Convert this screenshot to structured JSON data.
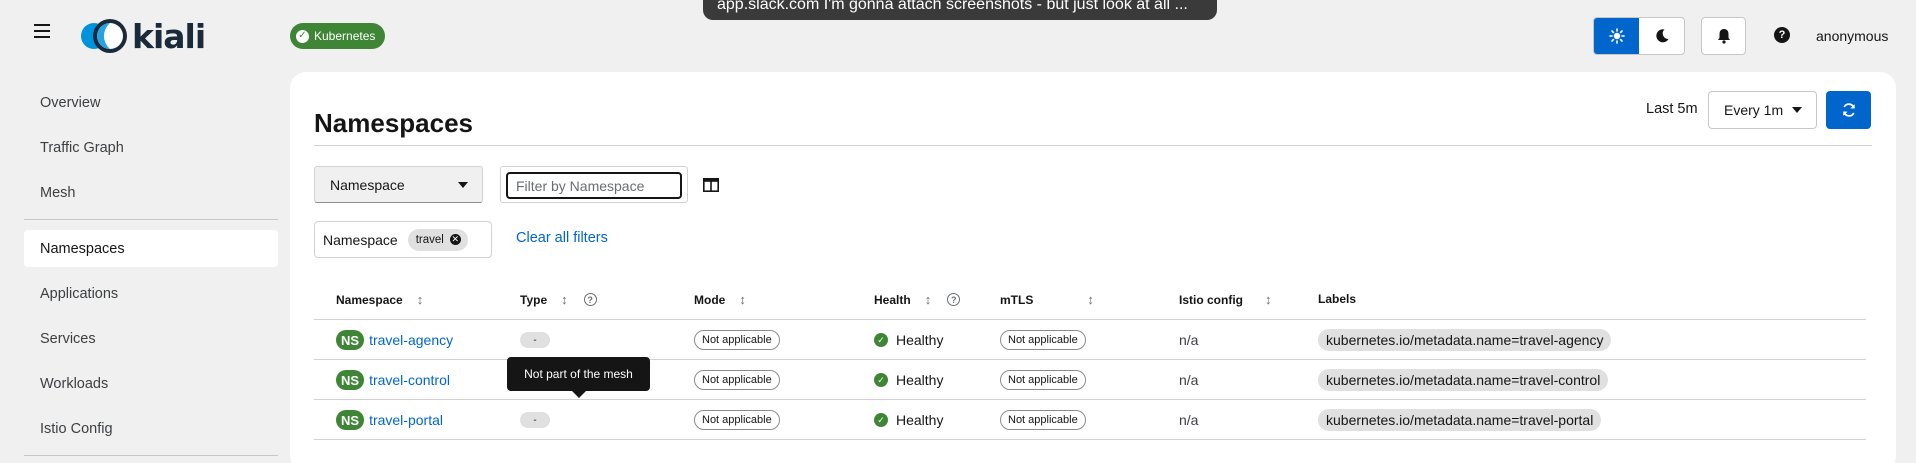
{
  "header": {
    "logo_text": "kiali",
    "cluster_badge": "Kubernetes",
    "toast_text": "app.slack.com   I'm gonna attach screenshots  - but just look at all ...",
    "user": "anonymous",
    "icons": {
      "menu": "hamburger-icon",
      "light_theme": "sun-icon",
      "dark_theme": "moon-icon",
      "notifications": "bell-icon",
      "help": "help-icon"
    }
  },
  "sidebar": {
    "items": [
      {
        "label": "Overview"
      },
      {
        "label": "Traffic Graph"
      },
      {
        "label": "Mesh"
      },
      {
        "label": "Namespaces",
        "active": true
      },
      {
        "label": "Applications"
      },
      {
        "label": "Services"
      },
      {
        "label": "Workloads"
      },
      {
        "label": "Istio Config"
      }
    ]
  },
  "main": {
    "title": "Namespaces",
    "time_range": "Last 5m",
    "refresh_interval": "Every 1m",
    "filter": {
      "type_label": "Namespace",
      "placeholder": "Filter by Namespace"
    },
    "active_filters": {
      "category": "Namespace",
      "chips": [
        "travel"
      ],
      "clear_label": "Clear all filters"
    },
    "table": {
      "columns": [
        "Namespace",
        "Type",
        "Mode",
        "Health",
        "mTLS",
        "Istio config",
        "Labels"
      ],
      "rows": [
        {
          "badge": "NS",
          "namespace": "travel-agency",
          "type": "-",
          "mode": "Not applicable",
          "health": "Healthy",
          "mtls": "Not applicable",
          "istio_config": "n/a",
          "labels": "kubernetes.io/metadata.name=travel-agency"
        },
        {
          "badge": "NS",
          "namespace": "travel-control",
          "type": "-",
          "mode": "Not applicable",
          "health": "Healthy",
          "mtls": "Not applicable",
          "istio_config": "n/a",
          "labels": "kubernetes.io/metadata.name=travel-control"
        },
        {
          "badge": "NS",
          "namespace": "travel-portal",
          "type": "-",
          "mode": "Not applicable",
          "health": "Healthy",
          "mtls": "Not applicable",
          "istio_config": "n/a",
          "labels": "kubernetes.io/metadata.name=travel-portal"
        }
      ]
    },
    "tooltip": "Not part of the mesh"
  },
  "colors": {
    "primary": "#0066cc",
    "success": "#3e8635",
    "background": "#f0f0f0",
    "card": "#ffffff"
  }
}
